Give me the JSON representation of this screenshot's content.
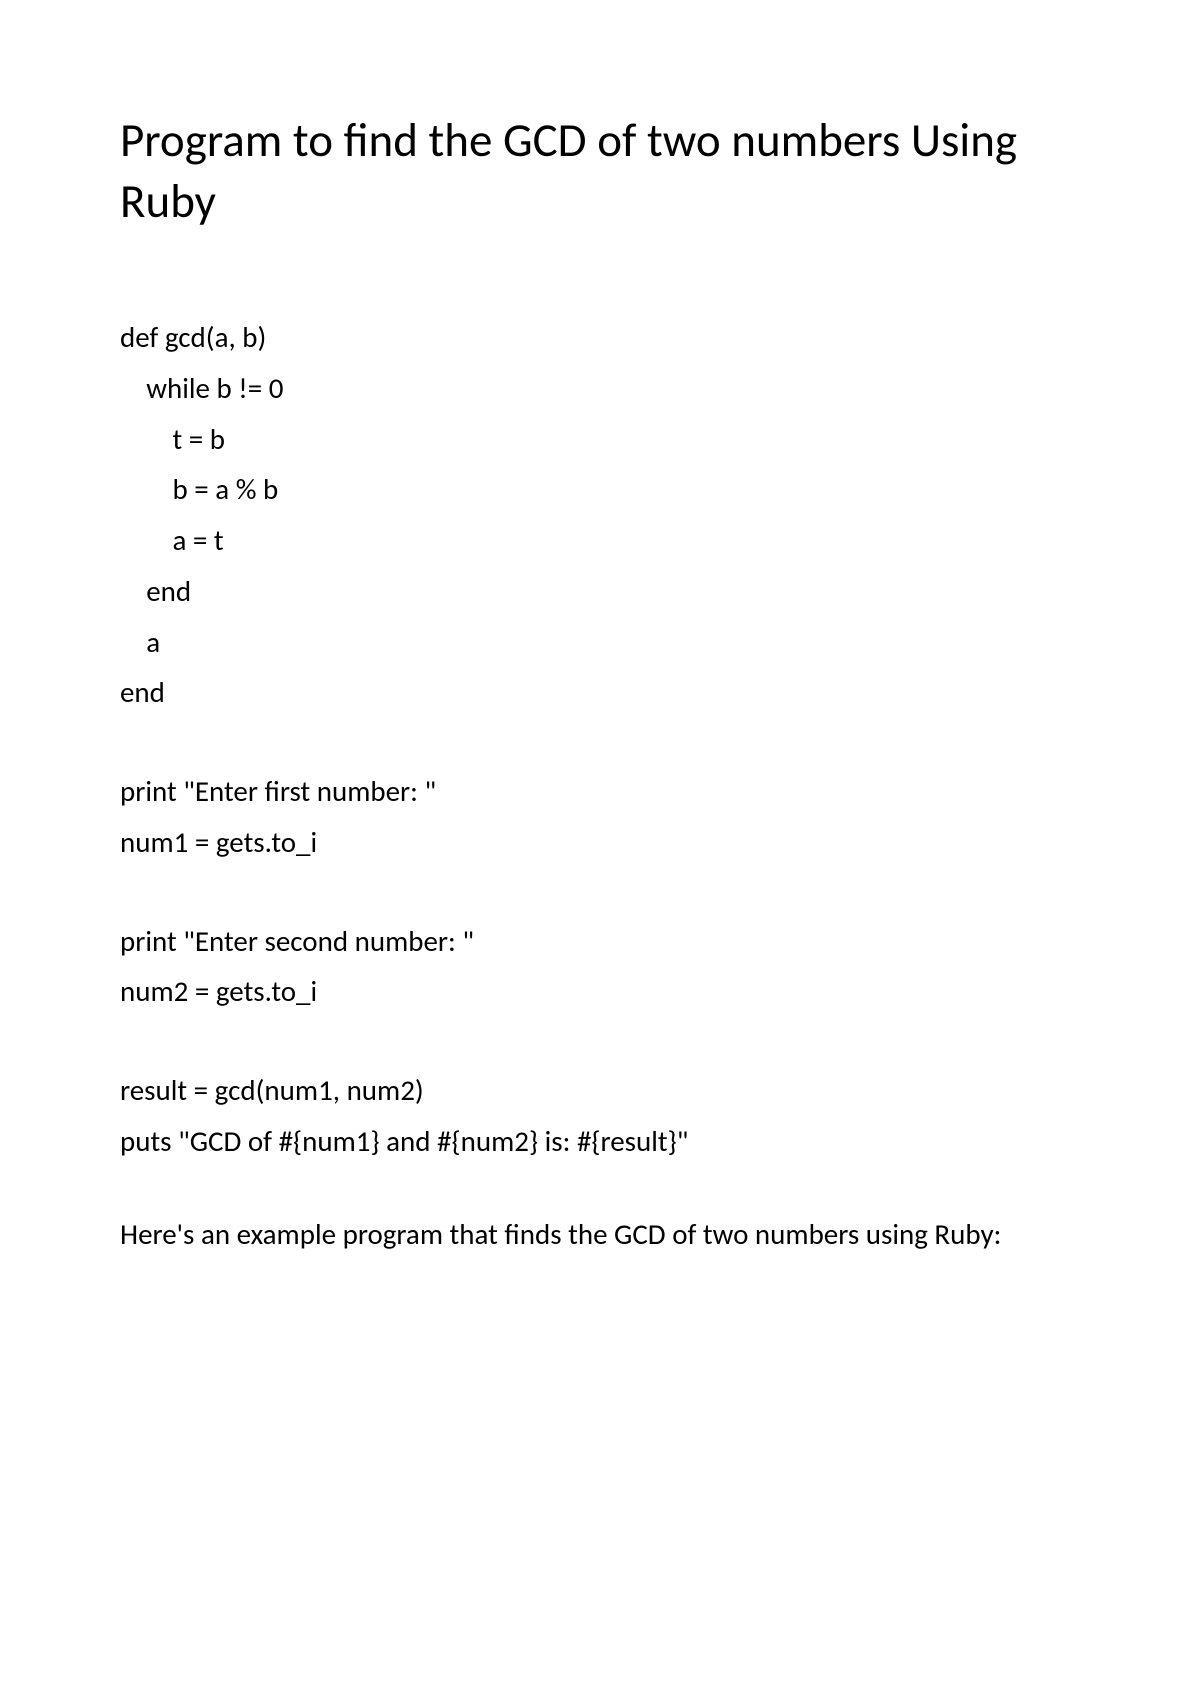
{
  "title": "Program to find the GCD of two numbers Using Ruby",
  "code": {
    "block1": {
      "line1": "def gcd(a, b)",
      "line2": "    while b != 0",
      "line3": "        t = b",
      "line4": "        b = a % b",
      "line5": "        a = t",
      "line6": "    end",
      "line7": "    a",
      "line8": "end"
    },
    "block2": {
      "line1": "print \"Enter first number: \"",
      "line2": "num1 = gets.to_i"
    },
    "block3": {
      "line1": "print \"Enter second number: \"",
      "line2": "num2 = gets.to_i"
    },
    "block4": {
      "line1": "result = gcd(num1, num2)",
      "line2": "puts \"GCD of #{num1} and #{num2} is: #{result}\""
    }
  },
  "description": "Here's an example program that finds the GCD of two numbers using Ruby:"
}
